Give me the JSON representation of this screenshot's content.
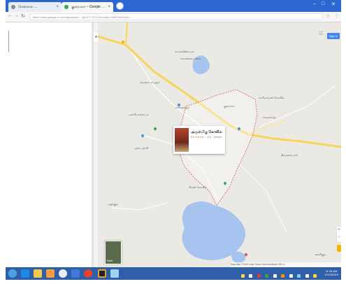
{
  "browser": {
    "tabs": [
      {
        "label": "சென்னை …",
        "active": false
      },
      {
        "label": "குறைகள் – Google …",
        "active": true
      }
    ],
    "close_glyph": "×",
    "address": "https://www.google.co.in/maps/place/…/@10.7,78.2,13z/data=!4m5!3m4!1s0x…",
    "nav": {
      "back": "←",
      "forward": "→",
      "reload": "↻"
    },
    "window_controls": [
      "–",
      "□",
      "✕"
    ],
    "star": "☆",
    "menu": "⋮"
  },
  "map": {
    "sign_in": "Sign in",
    "apps_glyph": "☷",
    "collapse_glyph": "◂",
    "zoom_in": "+",
    "zoom_out": "−",
    "earth_label": "Earth",
    "attribution": "Map data ©2019  India  Terms  Send feedback  500 m",
    "labels": [
      {
        "text": "காவல்நிலையம்"
      },
      {
        "text": "வெள்ளையாளை"
      },
      {
        "text": "வெங்கடராமுநுர்"
      },
      {
        "text": "குறைகள்"
      },
      {
        "text": "மாரியம்மன் கோவில்"
      },
      {
        "text": "பள்ளிபாளையம்"
      },
      {
        "text": "செல்லாந்துர்"
      },
      {
        "text": "அரசு பள்ளி"
      },
      {
        "text": "வெள்ளாறு"
      },
      {
        "text": "திருமலை நகர்"
      },
      {
        "text": "சிவன் கோவில்"
      },
      {
        "text": "புதுக்குடி"
      },
      {
        "text": "கள்ளிகுடி"
      }
    ],
    "info_card": {
      "title": "அருள்மிகு கோவில்",
      "rating": "4.5",
      "stars": "★★★★☆",
      "reviews": "(11) · Temple"
    }
  },
  "taskbar": {
    "clock_time": "11:25 AM",
    "clock_date": "12/10/2019"
  },
  "colors": {
    "titlebar": "#2b68d1",
    "water": "#a7c4ee",
    "main_road": "#f6d55c",
    "boundary": "#e05555",
    "taskbar": "#2f5fa8"
  }
}
